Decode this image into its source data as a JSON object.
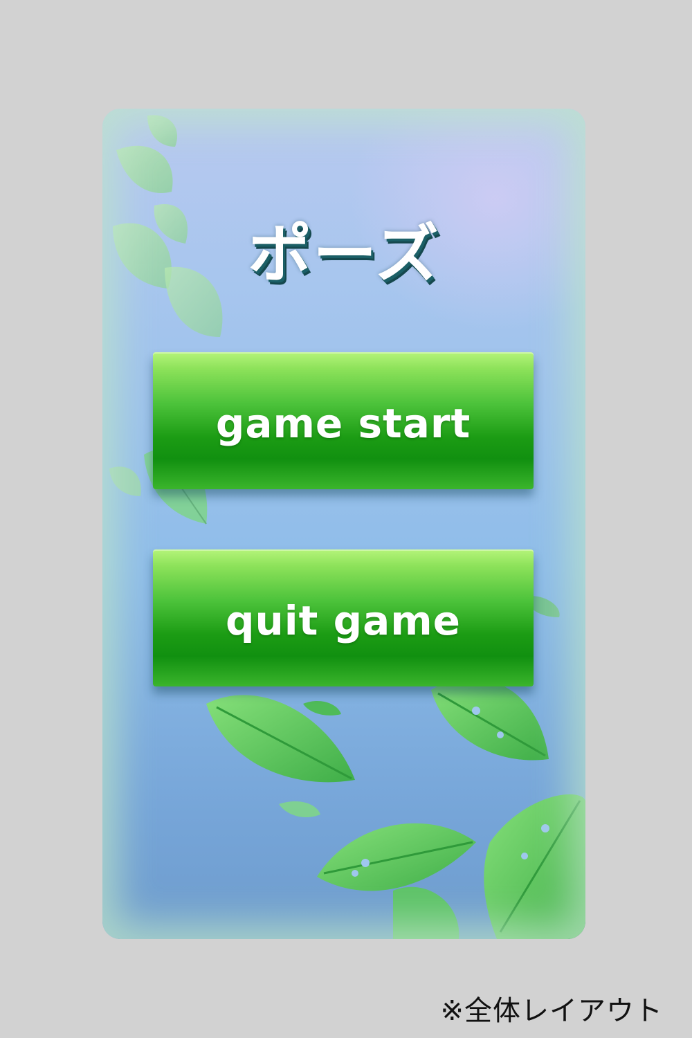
{
  "pause_menu": {
    "title": "ポーズ",
    "buttons": [
      {
        "label": "game start"
      },
      {
        "label": "quit game"
      }
    ]
  },
  "footnote": "※全体レイアウト",
  "colors": {
    "page_background": "#d2d2d2",
    "panel_sky": "#8fbde9",
    "button_green": "#1c9c14",
    "button_highlight": "#b5f47a",
    "title_shadow": "#1b5f66",
    "leaf_green": "#5ccc5c"
  },
  "decorations": {
    "leaf_icon": "leaf-icon"
  }
}
